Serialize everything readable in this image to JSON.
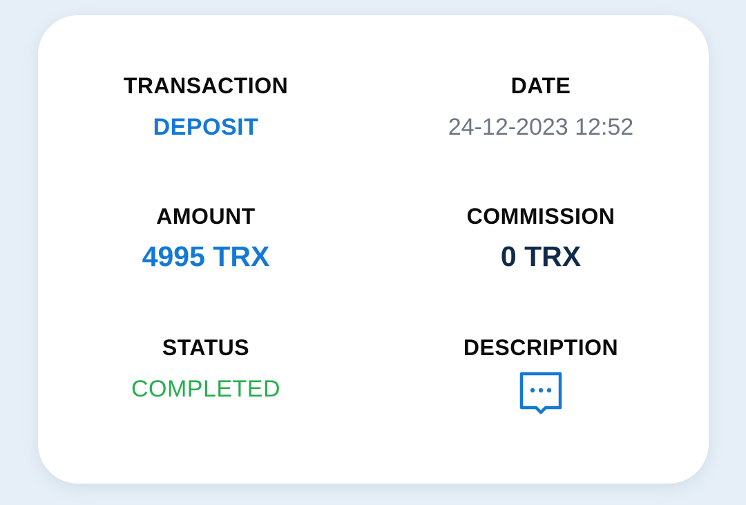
{
  "transaction": {
    "label": "TRANSACTION",
    "value": "DEPOSIT"
  },
  "date": {
    "label": "DATE",
    "value": "24-12-2023 12:52"
  },
  "amount": {
    "label": "AMOUNT",
    "value": "4995 TRX"
  },
  "commission": {
    "label": "COMMISSION",
    "value": "0 TRX"
  },
  "status": {
    "label": "STATUS",
    "value": "COMPLETED"
  },
  "description": {
    "label": "DESCRIPTION",
    "icon": "comment-dots-icon"
  },
  "colors": {
    "accent_blue": "#1479d6",
    "dark_navy": "#0f2a4a",
    "status_green": "#27ae4f",
    "muted_gray": "#6d7682",
    "page_background": "#e6eff7",
    "card_background": "#ffffff"
  }
}
